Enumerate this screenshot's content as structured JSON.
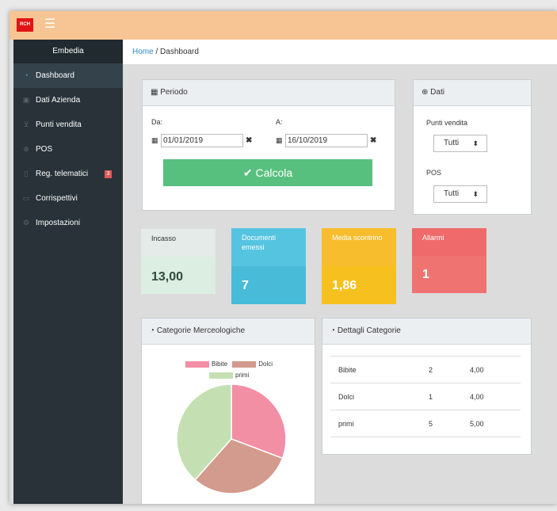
{
  "app": {
    "logo_text": "RCH",
    "menu_icon": "hamburger-icon"
  },
  "sidebar": {
    "brand": "Embedia",
    "items": [
      {
        "label": "Dashboard",
        "icon": "dashboard-icon",
        "active": true
      },
      {
        "label": "Dati Azienda",
        "icon": "briefcase-icon"
      },
      {
        "label": "Punti vendita",
        "icon": "cart-icon"
      },
      {
        "label": "POS",
        "icon": "globe-icon"
      },
      {
        "label": "Reg. telematici",
        "icon": "tablet-icon",
        "badge": "3"
      },
      {
        "label": "Corrispettivi",
        "icon": "folder-icon"
      },
      {
        "label": "Impostazioni",
        "icon": "gear-icon"
      }
    ]
  },
  "breadcrumb": {
    "home": "Home",
    "separator": "/",
    "current": "Dashboard"
  },
  "periodo": {
    "title": "Periodo",
    "from_label": "Da:",
    "from_value": "01/01/2019",
    "to_label": "A:",
    "to_value": "16/10/2019",
    "clear_symbol": "✖",
    "button_label": "Calcola",
    "button_icon": "✔"
  },
  "dati": {
    "title": "Dati",
    "punti_label": "Punti vendita",
    "punti_value": "Tutti",
    "pos_label": "POS",
    "pos_value": "Tutti",
    "select_arrow": "⬍"
  },
  "stats": [
    {
      "label": "Incasso",
      "value": "13,00",
      "header_color": "#e4ebe8",
      "body_color": "#dbeee1",
      "text_color": "#2f4a3a"
    },
    {
      "label": "Documenti emessi",
      "value": "7",
      "header_color": "#55c4e0",
      "body_color": "#48bbd9",
      "text_color": "#ffffff"
    },
    {
      "label": "Media scontrino",
      "value": "1,86",
      "header_color": "#f7bd2d",
      "body_color": "#f6c11f",
      "text_color": "#ffffff"
    },
    {
      "label": "Allarmi",
      "value": "1",
      "header_color": "#ef6b6b",
      "body_color": "#ee7371",
      "text_color": "#ffffff"
    }
  ],
  "categorie": {
    "title": "Categorie Merceologiche"
  },
  "dettagli": {
    "title": "Dettagli Categorie",
    "rows": [
      {
        "name": "Bibite",
        "qty": "2",
        "amount": "4,00"
      },
      {
        "name": "Dolci",
        "qty": "1",
        "amount": "4,00"
      },
      {
        "name": "primi",
        "qty": "5",
        "amount": "5,00"
      }
    ]
  },
  "chart_data": {
    "type": "pie",
    "categories": [
      "Bibite",
      "Dolci",
      "primi"
    ],
    "values": [
      4,
      4,
      5
    ],
    "colors": [
      "#f28fa5",
      "#d39b8d",
      "#c4e0b2"
    ],
    "legend_position": "top"
  }
}
